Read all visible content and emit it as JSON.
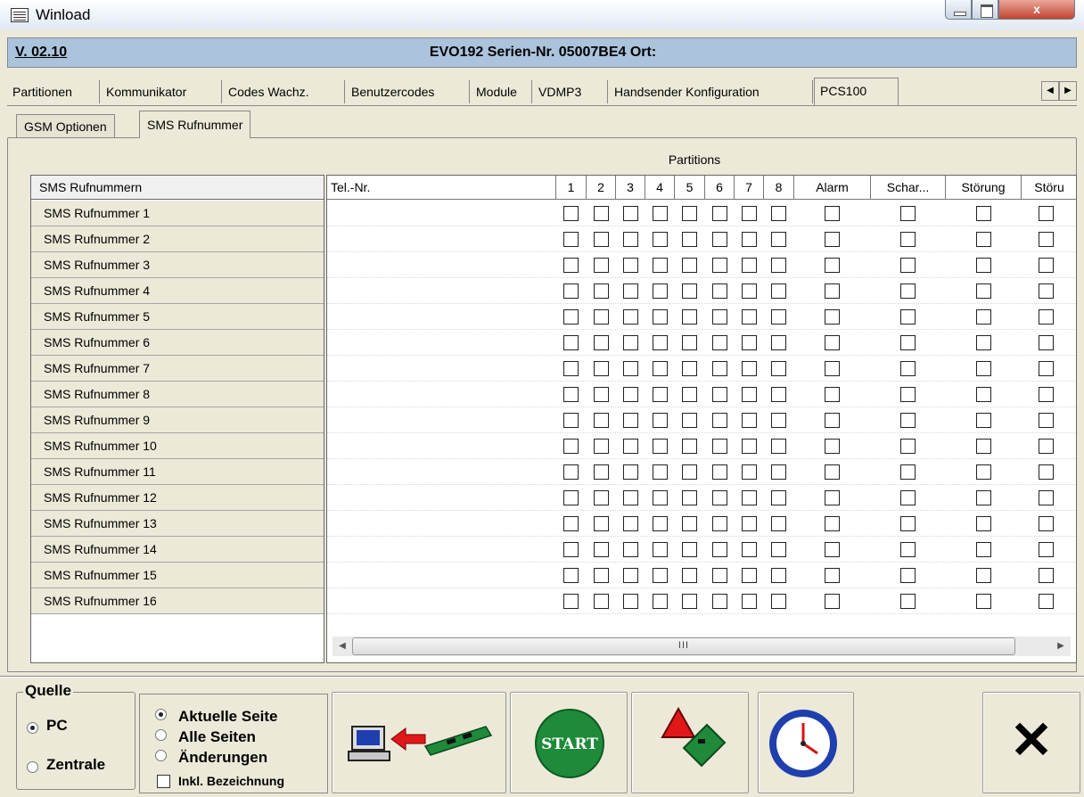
{
  "window": {
    "title": "Winload",
    "close_glyph": "x"
  },
  "infobar": {
    "version": "V. 02.10",
    "device": "EVO192  Serien-Nr. 05007BE4 Ort:"
  },
  "tabs": [
    {
      "label": "Partitionen"
    },
    {
      "label": "Kommunikator"
    },
    {
      "label": "Codes Wachz."
    },
    {
      "label": "Benutzercodes"
    },
    {
      "label": "Module"
    },
    {
      "label": "VDMP3"
    },
    {
      "label": "Handsender Konfiguration"
    },
    {
      "label": "PCS100",
      "active": true
    }
  ],
  "subtabs": [
    {
      "label": "GSM Optionen"
    },
    {
      "label": "SMS Rufnummer",
      "active": true
    }
  ],
  "grid": {
    "group_label": "Partitions",
    "list_header": "SMS Rufnummern",
    "columns": {
      "tel": "Tel.-Nr.",
      "p1": "1",
      "p2": "2",
      "p3": "3",
      "p4": "4",
      "p5": "5",
      "p6": "6",
      "p7": "7",
      "p8": "8",
      "alarm": "Alarm",
      "schar": "Schar...",
      "stoerung": "Störung",
      "stoeru": "Störu"
    },
    "rows": [
      "SMS Rufnummer 1",
      "SMS Rufnummer 2",
      "SMS Rufnummer 3",
      "SMS Rufnummer 4",
      "SMS Rufnummer 5",
      "SMS Rufnummer 6",
      "SMS Rufnummer 7",
      "SMS Rufnummer 8",
      "SMS Rufnummer 9",
      "SMS Rufnummer 10",
      "SMS Rufnummer 11",
      "SMS Rufnummer 12",
      "SMS Rufnummer 13",
      "SMS Rufnummer 14",
      "SMS Rufnummer 15",
      "SMS Rufnummer 16"
    ],
    "checked": false
  },
  "scrollbar": {
    "thumb_label": "III",
    "left_arrow": "◀",
    "right_arrow": "▶"
  },
  "bottom": {
    "quelle_title": "Quelle",
    "source_pc": "PC",
    "source_zentrale": "Zentrale",
    "scope_current": "Aktuelle Seite",
    "scope_all": "Alle Seiten",
    "scope_changes": "Änderungen",
    "include_label": "Inkl. Bezeichnung",
    "start_label": "START",
    "close_glyph": "✕"
  },
  "colors": {
    "infobar": "#abc4dc",
    "start_green": "#1e8a3a",
    "close_red": "#c3442f"
  }
}
